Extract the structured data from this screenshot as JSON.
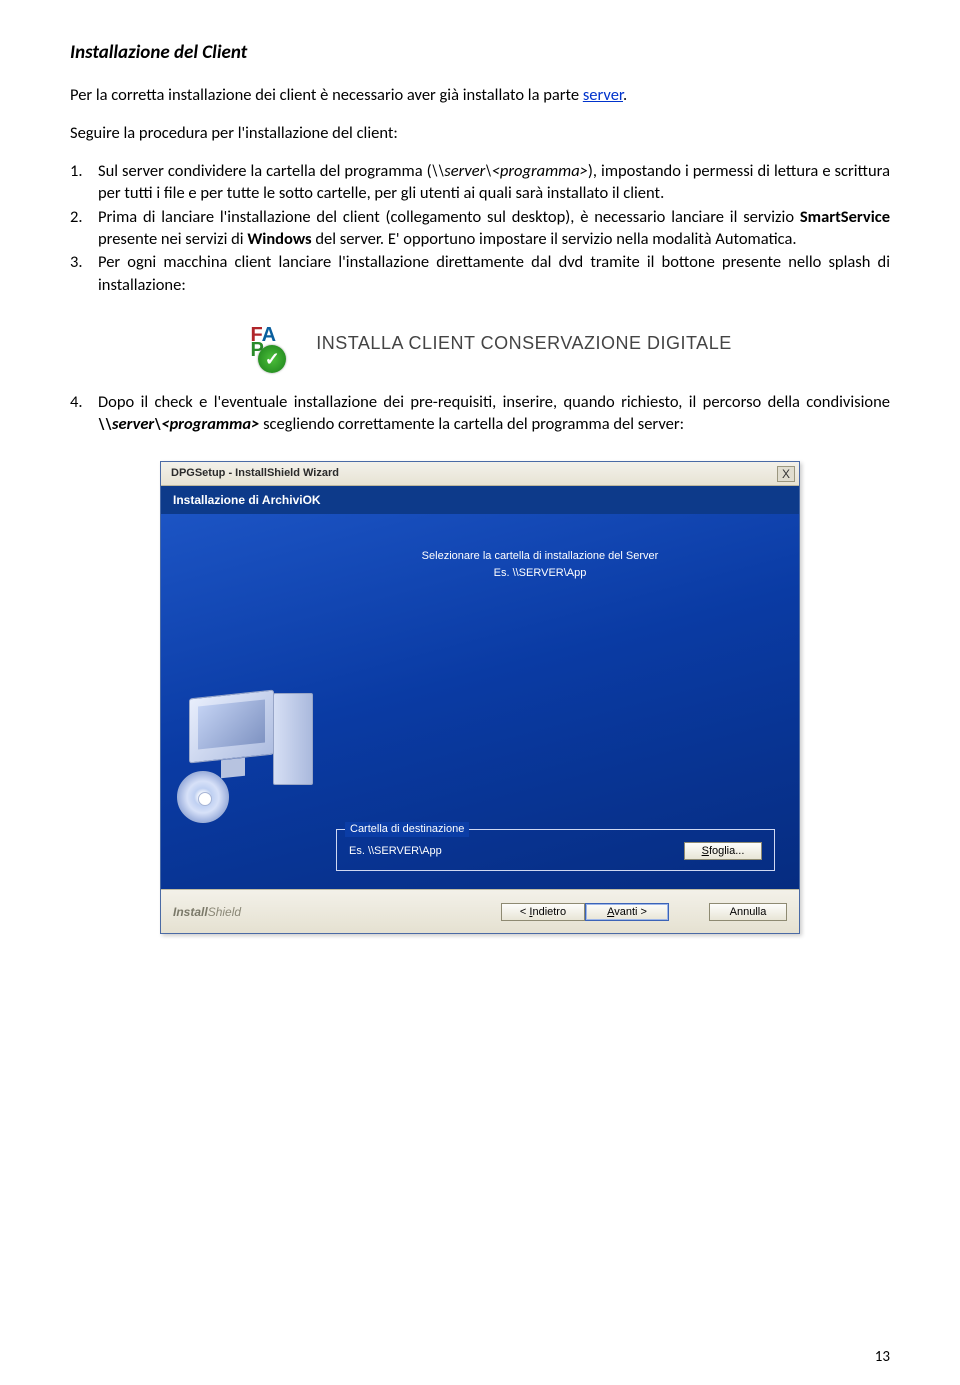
{
  "heading": "Installazione del Client",
  "intro_prefix": "Per la corretta installazione dei client è necessario aver già installato la parte ",
  "intro_link": "server",
  "intro_suffix": ".",
  "intro2": "Seguire la procedura per l'installazione del client:",
  "steps": {
    "s1_a": "Sul server condividere la cartella del programma (",
    "s1_b": "\\\\server\\<programma>",
    "s1_c": "), impostando i permessi di lettura e scrittura per tutti i file e per tutte le sotto cartelle, per gli utenti ai quali sarà installato il client.",
    "s2_a": "Prima di lanciare l'installazione del client (collegamento sul desktop), è necessario lanciare il servizio ",
    "s2_b": "SmartService",
    "s2_c": " presente nei servizi di ",
    "s2_d": "Windows",
    "s2_e": " del server. E' opportuno impostare il servizio nella modalità Automatica.",
    "s3": "Per ogni macchina client lanciare l'installazione direttamente dal dvd tramite il bottone presente nello splash di installazione:",
    "s4_a": "Dopo il check e l'eventuale installazione dei pre-requisiti, inserire, quando richiesto, il percorso della condivisione ",
    "s4_b": "\\\\server\\<programma>",
    "s4_c": " scegliendo correttamente la cartella del programma del server:"
  },
  "banner": {
    "fa_top": "FA",
    "fa_bottom": "P",
    "check": "✓",
    "text": "INSTALLA CLIENT CONSERVAZIONE DIGITALE"
  },
  "wizard": {
    "titlebar": "DPGSetup - InstallShield Wizard",
    "close": "X",
    "subtitle": "Installazione di ArchiviOK",
    "instruction_line1": "Selezionare la cartella di installazione del Server",
    "instruction_line2": "Es. \\\\SERVER\\App",
    "dest_label": "Cartella di destinazione",
    "dest_text": "Es. \\\\SERVER\\App",
    "browse_prefix": "S",
    "browse_rest": "foglia...",
    "back_prefix": "< ",
    "back_u": "I",
    "back_rest": "ndietro",
    "next_u": "A",
    "next_rest": "vanti >",
    "cancel": "Annulla",
    "brand_a": "Install",
    "brand_b": "Shield"
  },
  "page_number": "13"
}
